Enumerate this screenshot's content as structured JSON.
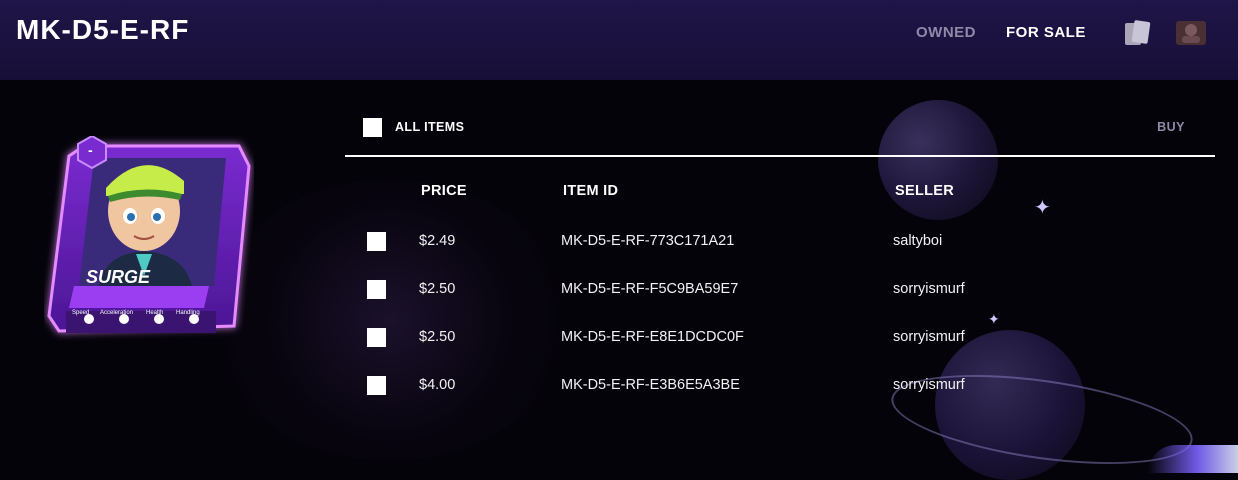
{
  "header": {
    "title": "MK-D5-E-RF",
    "tabs": [
      {
        "label": "OWNED",
        "active": false
      },
      {
        "label": "FOR SALE",
        "active": true
      }
    ],
    "icons": [
      "cards-icon",
      "avatar-icon"
    ]
  },
  "card": {
    "name": "SURGE",
    "badge": "-",
    "stats": [
      "Speed",
      "Acceleration",
      "Health",
      "Handling"
    ],
    "accent_color": "#b23cf0"
  },
  "table": {
    "all_items_label": "ALL ITEMS",
    "buy_label": "BUY",
    "columns": {
      "price": "PRICE",
      "item_id": "ITEM ID",
      "seller": "SELLER"
    },
    "rows": [
      {
        "price": "$2.49",
        "item_id": "MK-D5-E-RF-773C171A21",
        "seller": "saltyboi"
      },
      {
        "price": "$2.50",
        "item_id": "MK-D5-E-RF-F5C9BA59E7",
        "seller": "sorryismurf"
      },
      {
        "price": "$2.50",
        "item_id": "MK-D5-E-RF-E8E1DCDC0F",
        "seller": "sorryismurf"
      },
      {
        "price": "$4.00",
        "item_id": "MK-D5-E-RF-E3B6E5A3BE",
        "seller": "sorryismurf"
      }
    ]
  },
  "colors": {
    "header_bg": "#1d1444",
    "inactive_tab": "#8f8aa6",
    "page_bg": "#05030a"
  }
}
